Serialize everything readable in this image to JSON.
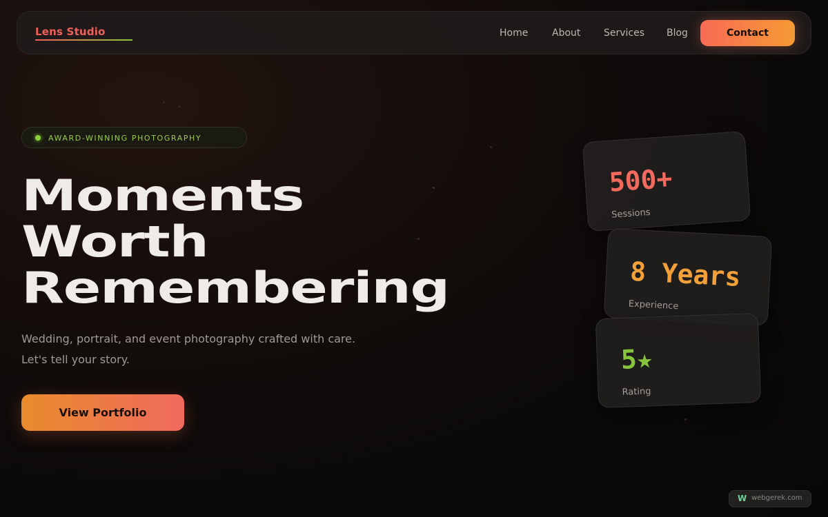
{
  "nav": {
    "brand": "Lens Studio",
    "links": [
      "Home",
      "About",
      "Services",
      "Blog"
    ],
    "contact": "Contact"
  },
  "hero": {
    "badge": "AWARD-WINNING PHOTOGRAPHY",
    "headline": [
      "Moments",
      "Worth",
      "Remembering"
    ],
    "subtitle_line1": "Wedding, portrait, and event photography crafted with care.",
    "subtitle_line2": "Let's tell your story.",
    "cta": "View Portfolio"
  },
  "stats": [
    {
      "value": "500+",
      "label": "Sessions",
      "color": "#f26a5e"
    },
    {
      "value": "8 Years",
      "label": "Experience",
      "color": "#f2a03a"
    },
    {
      "value": "5★",
      "label": "Rating",
      "color": "#86c53b"
    }
  ],
  "watermark": {
    "icon": "W",
    "text": "webgerek.com"
  },
  "colors": {
    "accent_red": "#f2605a",
    "accent_orange": "#f59a34",
    "accent_green": "#8cc63f",
    "background": "#0b0909"
  }
}
